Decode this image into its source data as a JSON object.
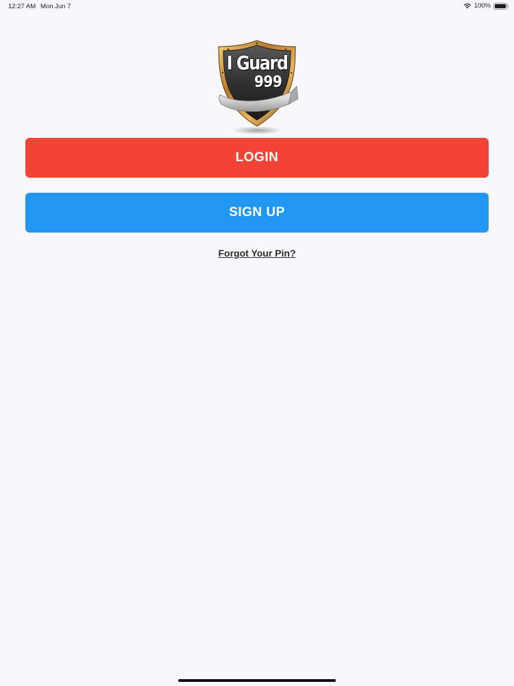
{
  "status_bar": {
    "time": "12:27 AM",
    "date": "Mon Jun 7",
    "battery_percent": "100%",
    "battery_level": 1.0,
    "wifi_icon": "wifi-icon",
    "battery_icon": "battery-icon"
  },
  "logo": {
    "title": "I Guard",
    "number": "999"
  },
  "buttons": {
    "login_label": "LOGIN",
    "login_color": "#f44336",
    "signup_label": "SIGN UP",
    "signup_color": "#2196f3"
  },
  "forgot_link": "Forgot Your Pin?"
}
